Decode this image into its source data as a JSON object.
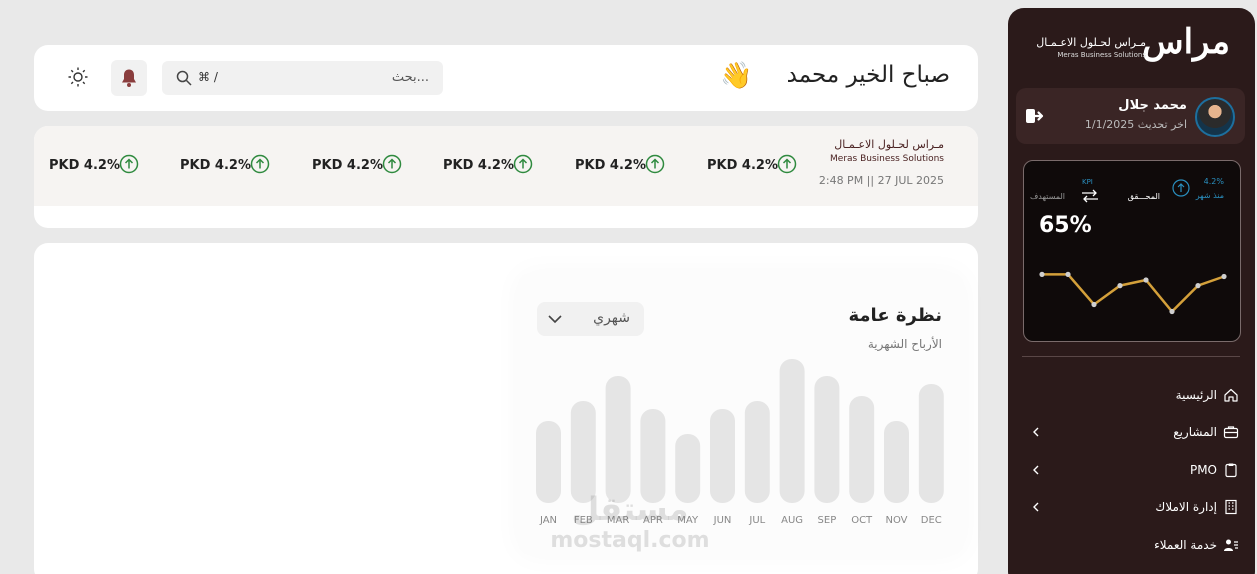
{
  "sidebar": {
    "logo_mark": "مراس",
    "logo_ar": "مـراس لحـلول الاعـمـال",
    "logo_en": "Meras Business Solutions",
    "profile": {
      "name": "محمد جلال",
      "subtitle": "اخر تحديث 1/1/2025"
    },
    "kpi": {
      "pct": "4.2%",
      "since": "منذ شهر",
      "label": "KPI",
      "achieved": "المحـــقق",
      "target": "المستهدف",
      "value": "65%",
      "spark": [
        0.78,
        0.78,
        0.35,
        0.62,
        0.7,
        0.25,
        0.62,
        0.75
      ],
      "accent": "#d4a03a"
    },
    "menu": [
      {
        "label": "الرئيسية",
        "icon": "home-icon",
        "has_chevron": false
      },
      {
        "label": "المشاريع",
        "icon": "briefcase-icon",
        "has_chevron": true
      },
      {
        "label": "PMO",
        "icon": "clipboard-icon",
        "has_chevron": true
      },
      {
        "label": "إدارة الاملاك",
        "icon": "building-icon",
        "has_chevron": true
      },
      {
        "label": "خدمة العملاء",
        "icon": "users-icon",
        "has_chevron": false
      }
    ]
  },
  "header": {
    "greeting": "صباح الخير محمد",
    "wave_emoji": "👋",
    "search_placeholder": "بحث...",
    "search_shortcut": "⌘ /"
  },
  "ticker": {
    "logo_ar": "مـراس لحـلول الاعـمـال",
    "logo_en": "Meras Business Solutions",
    "date": "2:48 PM || 27 JUL 2025",
    "items": [
      "PKD 4.2%",
      "PKD 4.2%",
      "PKD 4.2%",
      "PKD 4.2%",
      "PKD 4.2%",
      "PKD 4.2%"
    ],
    "up_color": "#2f8a3f"
  },
  "overview": {
    "title": "نظرة عامة",
    "subtitle": "الأرباح الشهرية",
    "period": "شهري"
  },
  "chart_data": {
    "type": "bar",
    "categories": [
      "JAN",
      "FEB",
      "MAR",
      "APR",
      "MAY",
      "JUN",
      "JUL",
      "AUG",
      "SEP",
      "OCT",
      "NOV",
      "DEC"
    ],
    "values": [
      82,
      102,
      127,
      94,
      69,
      94,
      102,
      144,
      127,
      107,
      82,
      119
    ],
    "ylim": [
      0,
      150
    ],
    "bar_color": "#e5e5e5"
  },
  "watermark": {
    "ar": "مستقل",
    "en": "mostaql.com"
  }
}
